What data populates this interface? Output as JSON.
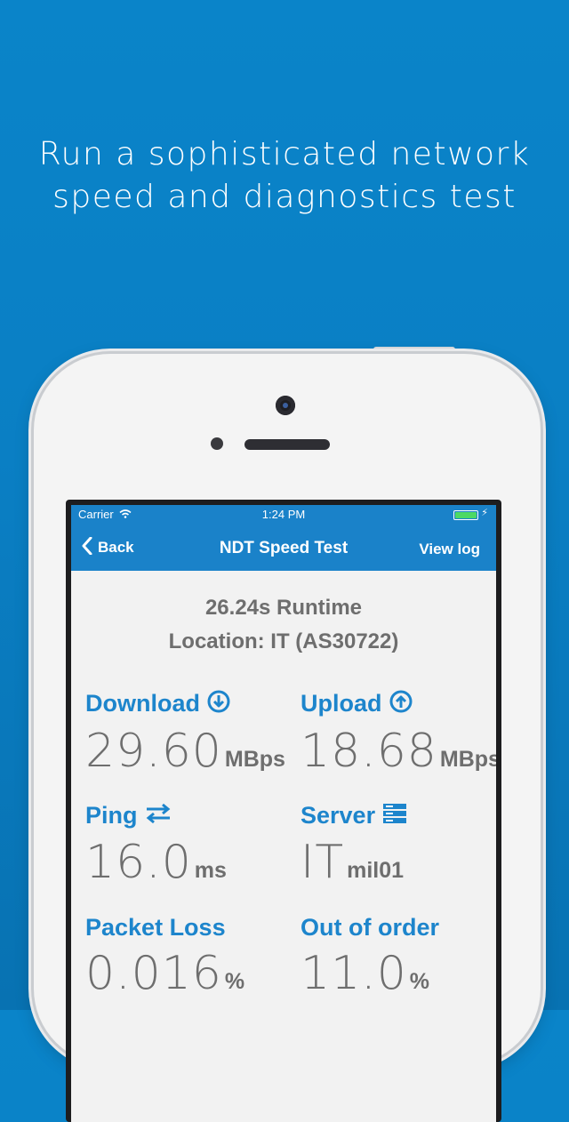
{
  "headline": {
    "line1": "Run a sophisticated network",
    "line2": "speed and diagnostics test"
  },
  "status_bar": {
    "carrier": "Carrier",
    "time": "1:24 PM"
  },
  "nav": {
    "back_label": "Back",
    "title": "NDT Speed Test",
    "view_log_label": "View log"
  },
  "summary": {
    "runtime": "26.24s Runtime",
    "location": "Location: IT (AS30722)"
  },
  "metrics": {
    "download": {
      "label": "Download",
      "value": "29.60",
      "unit": "MBps",
      "icon": "arrow-down-circle-icon"
    },
    "upload": {
      "label": "Upload",
      "value": "18.68",
      "unit": "MBps",
      "icon": "arrow-up-circle-icon"
    },
    "ping": {
      "label": "Ping",
      "value": "16.0",
      "unit": "ms",
      "icon": "swap-arrows-icon"
    },
    "server": {
      "label": "Server",
      "value": "IT",
      "unit": "mil01",
      "icon": "server-icon"
    },
    "packet_loss": {
      "label": "Packet Loss",
      "value": "0.016",
      "unit": "%"
    },
    "out_of_order": {
      "label": "Out of order",
      "value": "11.0",
      "unit": "%"
    }
  },
  "colors": {
    "background": "#0a84c9",
    "navbar": "#1a82c9",
    "accent": "#1d85cc",
    "value_text": "#6e6e6e",
    "battery": "#4cd964"
  }
}
